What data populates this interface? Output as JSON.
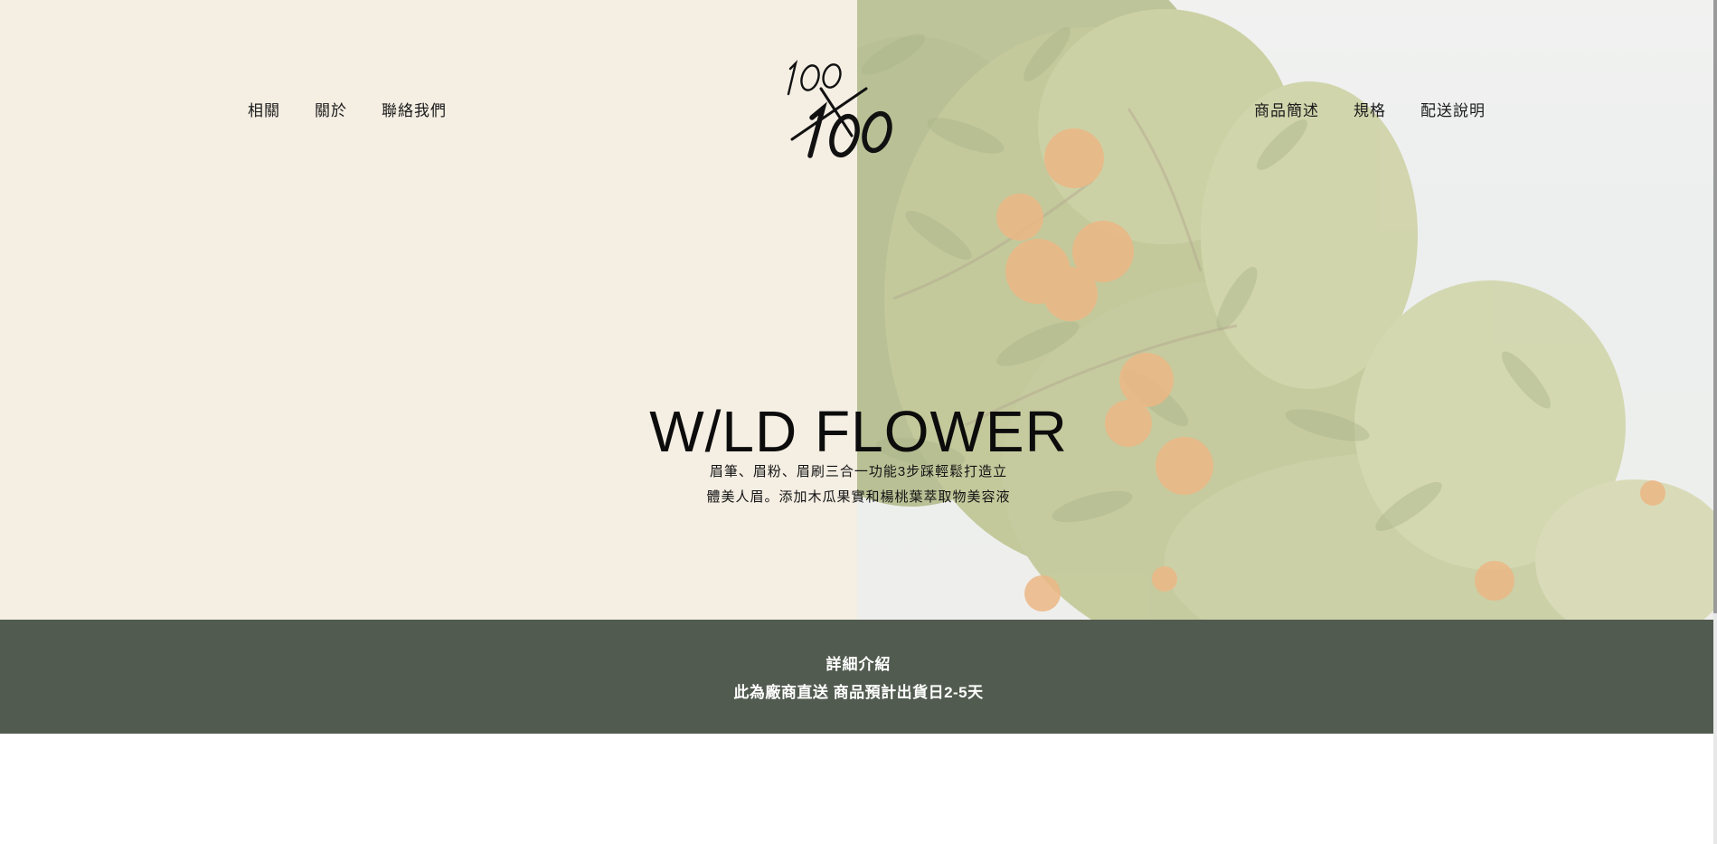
{
  "nav_left": {
    "items": [
      {
        "label": "相關"
      },
      {
        "label": "關於"
      },
      {
        "label": "聯絡我們"
      }
    ]
  },
  "nav_right": {
    "items": [
      {
        "label": "商品簡述"
      },
      {
        "label": "規格"
      },
      {
        "label": "配送說明"
      }
    ]
  },
  "logo": {
    "icon": "100x100-logo-icon"
  },
  "hero": {
    "title": "W/LD FLOWER",
    "subtitle_line1": "眉筆、眉粉、眉刷三合一功能3步踩輕鬆打造立",
    "subtitle_line2": "體美人眉。添加木瓜果實和楊桃葉萃取物美容液",
    "background_image": "orange-tree-image"
  },
  "banner": {
    "title": "詳細介紹",
    "note": "此為廠商直送 商品預計出貨日2-5天"
  },
  "colors": {
    "hero_left_bg": "#f4eee3",
    "banner_bg": "#515b4f",
    "banner_text": "#ffffff",
    "text": "#111111"
  }
}
